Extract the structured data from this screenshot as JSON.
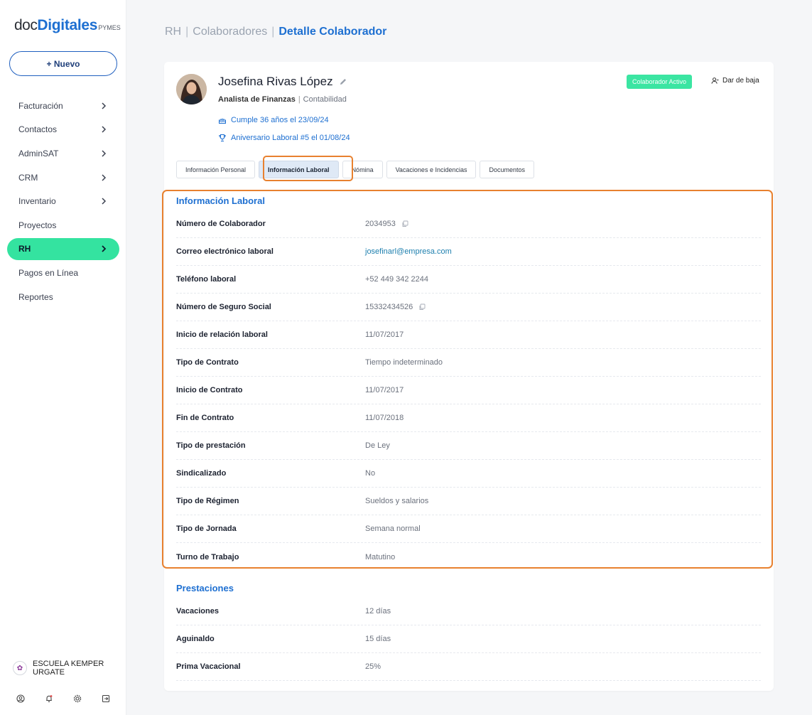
{
  "brand": {
    "doc": "doc",
    "digitales": "Digitales",
    "pymes": "PYMES"
  },
  "sidebar": {
    "new_label": "+ Nuevo",
    "items": [
      {
        "label": "Facturación",
        "chevron": true
      },
      {
        "label": "Contactos",
        "chevron": true
      },
      {
        "label": "AdminSAT",
        "chevron": true
      },
      {
        "label": "CRM",
        "chevron": true
      },
      {
        "label": "Inventario",
        "chevron": true
      },
      {
        "label": "Proyectos",
        "chevron": false
      },
      {
        "label": "RH",
        "chevron": true,
        "active": true
      },
      {
        "label": "Pagos en Línea",
        "chevron": false
      },
      {
        "label": "Reportes",
        "chevron": false
      }
    ],
    "org_name": "ESCUELA KEMPER URGATE",
    "bottom_icons": [
      "user-icon",
      "bell-icon",
      "gear-icon",
      "logout-icon"
    ]
  },
  "breadcrumb": {
    "item1": "RH",
    "sep": "|",
    "item2": "Colaboradores",
    "current": "Detalle Colaborador"
  },
  "employee": {
    "name": "Josefina Rivas López",
    "position": "Analista de Finanzas",
    "department": "Contabilidad",
    "birthday": "Cumple 36 años el 23/09/24",
    "anniversary": "Aniversario Laboral #5 el 01/08/24",
    "status": "Colaborador Activo",
    "dismiss_label": "Dar de baja"
  },
  "tabs": [
    "Información Personal",
    "Información Laboral",
    "Nómina",
    "Vacaciones e Incidencias",
    "Documentos"
  ],
  "active_tab": "Información Laboral",
  "labor_info": {
    "title": "Información Laboral",
    "rows": [
      {
        "label": "Número de Colaborador",
        "value": "2034953"
      },
      {
        "label": "Correo electrónico laboral",
        "value": "josefinarl@empresa.com"
      },
      {
        "label": "Teléfono laboral",
        "value": "+52 449 342 2244"
      },
      {
        "label": "Número de Seguro Social",
        "value": "15332434526"
      },
      {
        "label": "Inicio de relación laboral",
        "value": "11/07/2017"
      },
      {
        "label": "Tipo de Contrato",
        "value": "Tiempo indeterminado"
      },
      {
        "label": "Inicio de Contrato",
        "value": "11/07/2017"
      },
      {
        "label": "Fin de Contrato",
        "value": "11/07/2018"
      },
      {
        "label": "Tipo de prestación",
        "value": "De Ley"
      },
      {
        "label": "Sindicalizado",
        "value": "No"
      },
      {
        "label": "Tipo de Régimen",
        "value": "Sueldos y salarios"
      },
      {
        "label": "Tipo de Jornada",
        "value": "Semana normal"
      },
      {
        "label": "Turno de Trabajo",
        "value": "Matutino"
      }
    ]
  },
  "benefits": {
    "title": "Prestaciones",
    "rows": [
      {
        "label": "Vacaciones",
        "value": "12 días"
      },
      {
        "label": "Aguinaldo",
        "value": "15 días"
      },
      {
        "label": "Prima Vacacional",
        "value": "25%"
      }
    ]
  },
  "colors": {
    "accent": "#1d6fd1",
    "active_nav": "#34e3a0",
    "highlight": "#e8812f",
    "badge": "#3be5a2"
  }
}
